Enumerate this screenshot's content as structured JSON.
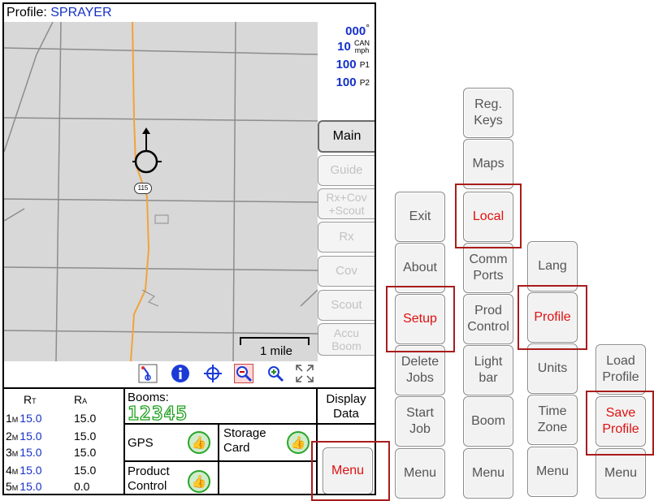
{
  "profile": {
    "label": "Profile:",
    "value": "SPRAYER"
  },
  "status": {
    "heading": {
      "value": "000",
      "unit": "°"
    },
    "speed": {
      "value": "10",
      "unit_top": "CAN",
      "unit_bottom": "mph"
    },
    "p1": {
      "value": "100",
      "unit": "P1"
    },
    "p2": {
      "value": "100",
      "unit": "P2"
    }
  },
  "map": {
    "road_marker": "115",
    "scale_label": "1 mile"
  },
  "tabs": [
    {
      "label": "Main"
    },
    {
      "label": "Guide"
    },
    {
      "label": "Rx+Cov\n+Scout"
    },
    {
      "label": "Rx"
    },
    {
      "label": "Cov"
    },
    {
      "label": "Scout"
    },
    {
      "label": "Accu\nBoom"
    }
  ],
  "toolbar": [
    "route-icon",
    "info-icon",
    "crosshair-icon",
    "zoom-out-icon",
    "zoom-in-icon",
    "expand-icon"
  ],
  "rates": {
    "header_t": "R",
    "header_t_sub": "T",
    "header_a": "R",
    "header_a_sub": "A",
    "rows": [
      {
        "num": "1",
        "sub": "M",
        "target": "15.0",
        "actual": "15.0"
      },
      {
        "num": "2",
        "sub": "M",
        "target": "15.0",
        "actual": "15.0"
      },
      {
        "num": "3",
        "sub": "M",
        "target": "15.0",
        "actual": "15.0"
      },
      {
        "num": "4",
        "sub": "M",
        "target": "15.0",
        "actual": "15.0"
      },
      {
        "num": "5",
        "sub": "M",
        "target": "15.0",
        "actual": "0.0"
      }
    ]
  },
  "booms": {
    "label": "Booms:",
    "sections": "12345"
  },
  "gps": {
    "label": "GPS"
  },
  "storage": {
    "label": "Storage\nCard"
  },
  "product_control": {
    "label": "Product\nControl"
  },
  "display_data": {
    "label": "Display\nData"
  },
  "menu_main": {
    "label": "Menu"
  },
  "menu_columns": {
    "col1": [
      "Exit",
      "About",
      "Setup",
      "Delete\nJobs",
      "Start\nJob",
      "Menu"
    ],
    "col2": [
      "Reg.\nKeys",
      "Maps",
      "Local",
      "Comm\nPorts",
      "Prod\nControl",
      "Light\nbar",
      "Boom",
      "Menu"
    ],
    "col3": [
      "Lang",
      "Profile",
      "Units",
      "Time\nZone",
      "Menu"
    ],
    "col4": [
      "Load\nProfile",
      "Save\nProfile",
      "Menu"
    ]
  },
  "colors": {
    "accent_blue": "#1530c8",
    "highlight_red": "#a81c1c",
    "road_orange": "#f2a33a",
    "boom_green": "#22a022"
  }
}
